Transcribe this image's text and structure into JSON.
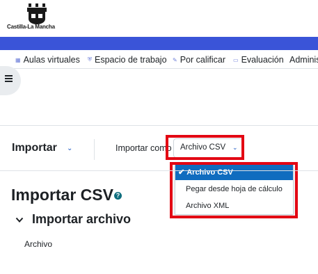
{
  "logo": {
    "text": "Castilla-La Mancha"
  },
  "nav": {
    "items": [
      {
        "label": "Aulas virtuales",
        "icon": "grid-icon"
      },
      {
        "label": "Espacio de trabajo",
        "icon": "shield-icon"
      },
      {
        "label": "Por calificar",
        "icon": "pencil-icon"
      },
      {
        "label": "Evaluación",
        "icon": "calendar-icon"
      },
      {
        "label": "Adminis",
        "icon": ""
      }
    ]
  },
  "importar_menu": {
    "title": "Importar",
    "como_label": "Importar como",
    "selected": "Archivo CSV",
    "options": [
      "Archivo CSV",
      "Pegar desde hoja de cálculo",
      "Archivo XML"
    ]
  },
  "page": {
    "heading": "Importar CSV",
    "help_icon_glyph": "?",
    "section_title": "Importar archivo",
    "field_label": "Archivo"
  },
  "colors": {
    "band": "#3a54d8",
    "highlight": "#e30613",
    "selected_option": "#0f6cbf"
  }
}
